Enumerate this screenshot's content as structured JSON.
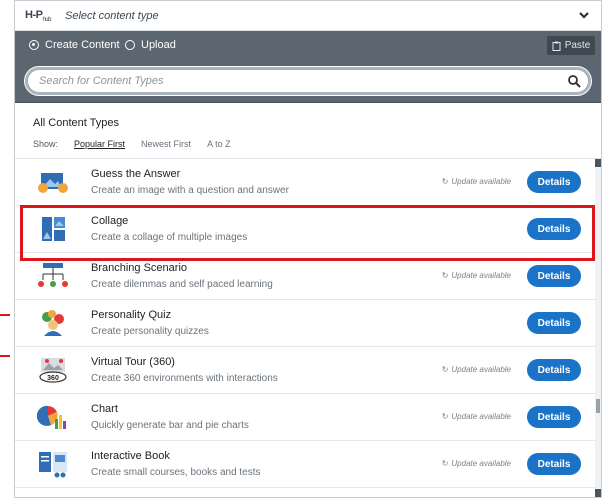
{
  "header": {
    "logo": "H-P",
    "logo_sub": "hub",
    "title": "Select content type"
  },
  "tabs": {
    "create": "Create Content",
    "upload": "Upload",
    "paste": "Paste"
  },
  "search": {
    "placeholder": "Search for Content Types"
  },
  "list_header": {
    "title": "All Content Types",
    "show_label": "Show:",
    "sort_popular": "Popular First",
    "sort_newest": "Newest First",
    "sort_az": "A to Z"
  },
  "items": [
    {
      "title": "Guess the Answer",
      "desc": "Create an image with a question and answer",
      "update": "Update available",
      "button": "Details",
      "icon": "guess-answer-icon"
    },
    {
      "title": "Collage",
      "desc": "Create a collage of multiple images",
      "update": "",
      "button": "Details",
      "icon": "collage-icon"
    },
    {
      "title": "Branching Scenario",
      "desc": "Create dilemmas and self paced learning",
      "update": "Update available",
      "button": "Details",
      "icon": "branching-icon"
    },
    {
      "title": "Personality Quiz",
      "desc": "Create personality quizzes",
      "update": "",
      "button": "Details",
      "icon": "personality-quiz-icon"
    },
    {
      "title": "Virtual Tour (360)",
      "desc": "Create 360 environments with interactions",
      "update": "Update available",
      "button": "Details",
      "icon": "virtual-tour-icon"
    },
    {
      "title": "Chart",
      "desc": "Quickly generate bar and pie charts",
      "update": "Update available",
      "button": "Details",
      "icon": "chart-icon"
    },
    {
      "title": "Interactive Book",
      "desc": "Create small courses, books and tests",
      "update": "Update available",
      "button": "Details",
      "icon": "interactive-book-icon"
    }
  ],
  "colors": {
    "accent": "#1a73c7",
    "header_bar": "#5b6670",
    "highlight": "#e0141b"
  }
}
